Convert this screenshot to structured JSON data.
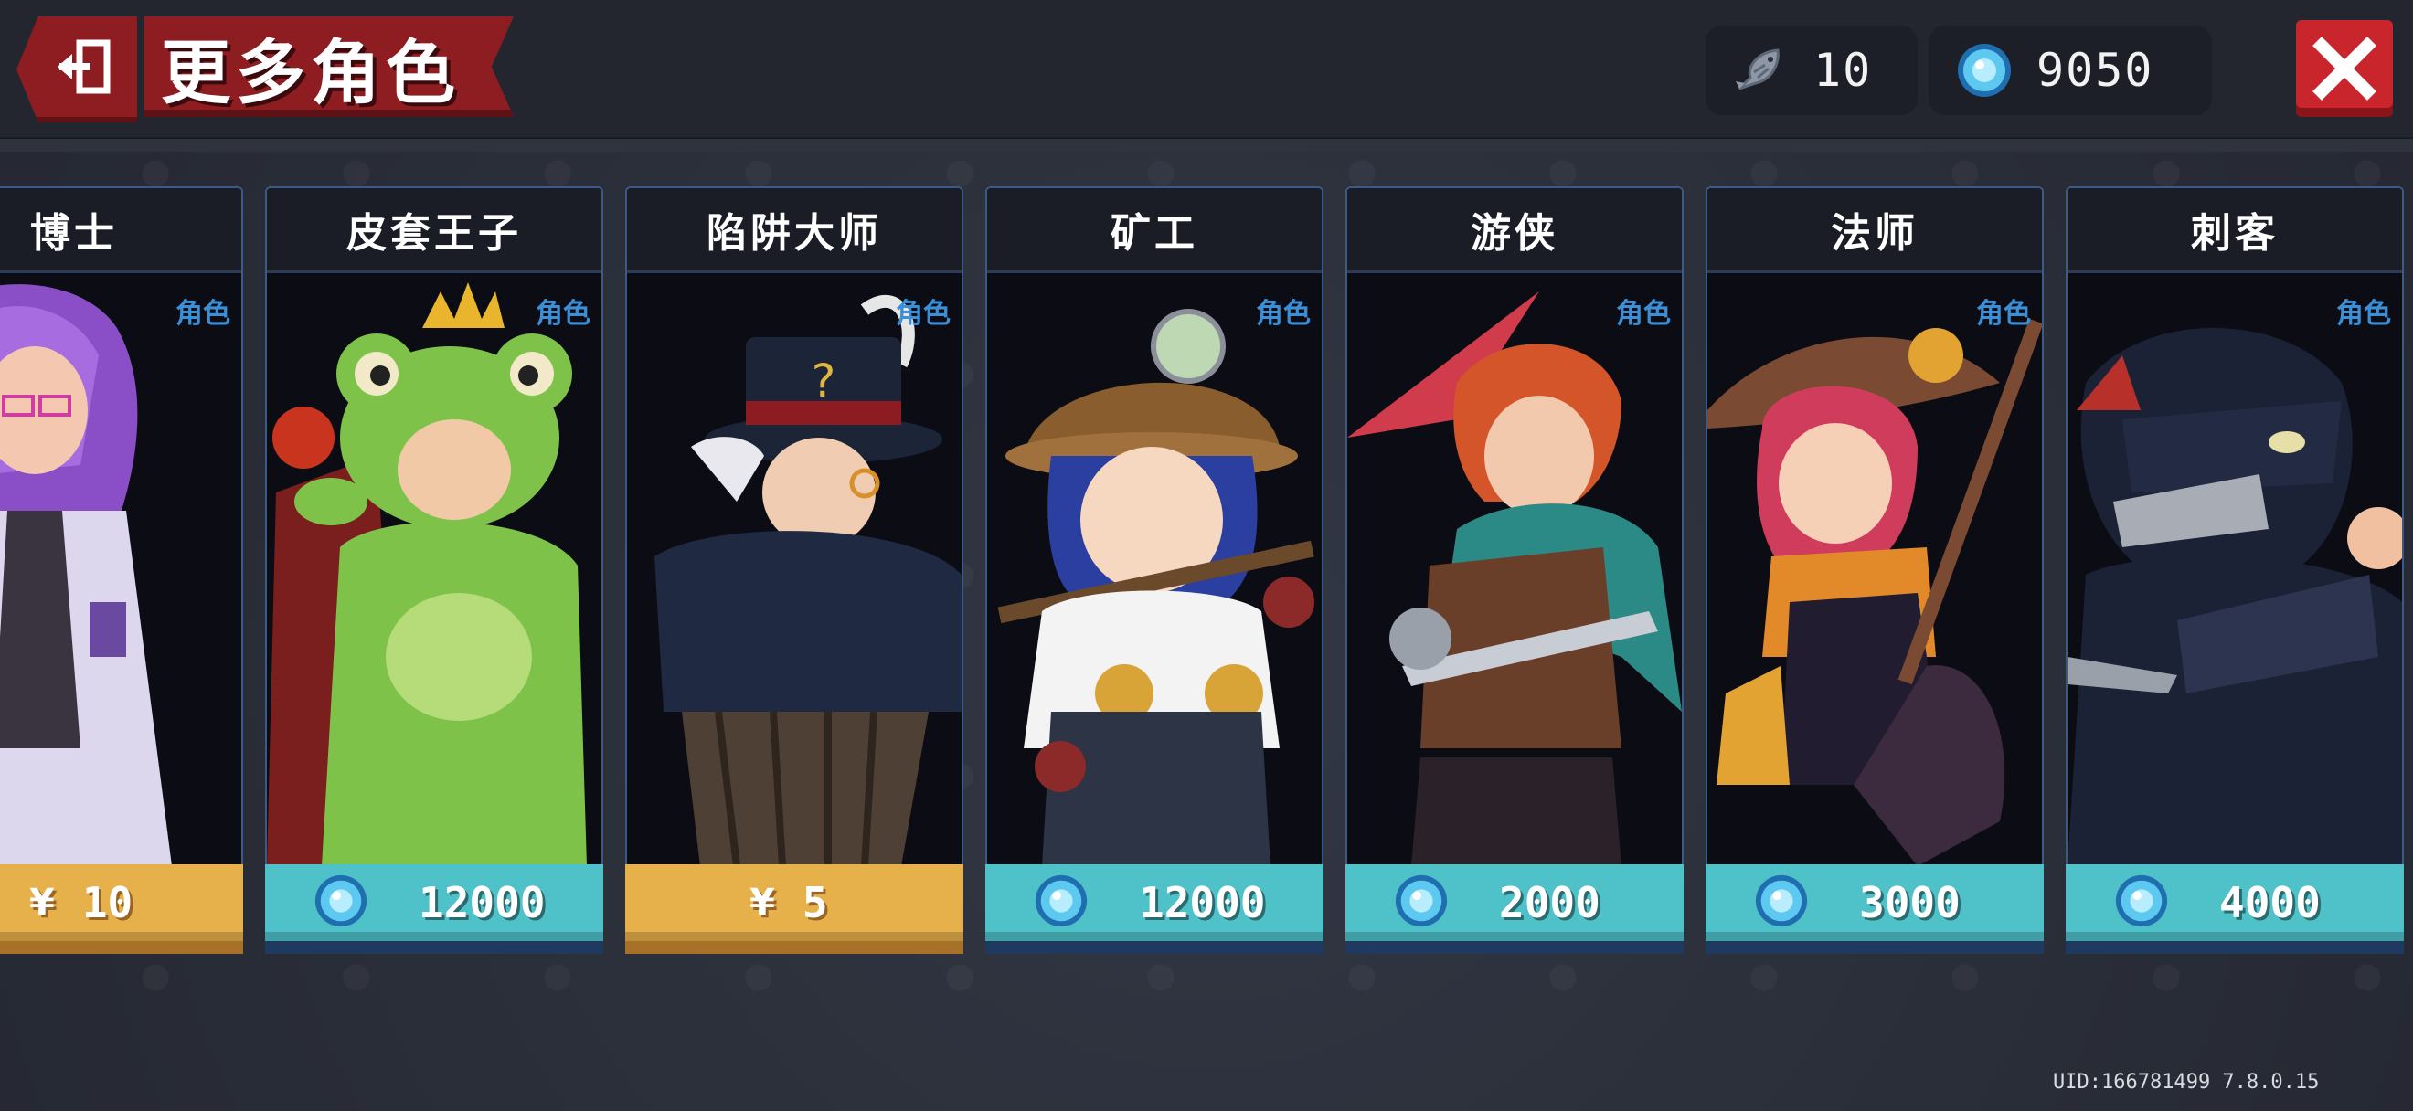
{
  "header": {
    "title": "更多角色",
    "fish_count": "10",
    "gem_count": "9050"
  },
  "cards": [
    {
      "name": "博士",
      "tag": "角色",
      "price_type": "cash",
      "currency": "¥",
      "price": "10",
      "art": "doctor"
    },
    {
      "name": "皮套王子",
      "tag": "角色",
      "price_type": "gem",
      "price": "12000",
      "art": "frog-prince"
    },
    {
      "name": "陷阱大师",
      "tag": "角色",
      "price_type": "cash",
      "currency": "¥",
      "price": "5",
      "art": "trap-master"
    },
    {
      "name": "矿工",
      "tag": "角色",
      "price_type": "gem",
      "price": "12000",
      "art": "miner"
    },
    {
      "name": "游侠",
      "tag": "角色",
      "price_type": "gem",
      "price": "2000",
      "art": "ranger"
    },
    {
      "name": "法师",
      "tag": "角色",
      "price_type": "gem",
      "price": "3000",
      "art": "mage"
    },
    {
      "name": "刺客",
      "tag": "角色",
      "price_type": "gem",
      "price": "4000",
      "art": "assassin"
    }
  ],
  "footer": {
    "uid": "UID:166781499 7.8.0.15"
  },
  "colors": {
    "banner_red": "#8e1d22",
    "gem_price_bg": "#4fc1c8",
    "cash_price_bg": "#e6b04a",
    "role_tag": "#3b8fd6"
  },
  "icons": {
    "back": "exit-door-icon",
    "fish": "fish-icon",
    "gem": "blue-gem-icon",
    "close": "close-x-icon"
  }
}
